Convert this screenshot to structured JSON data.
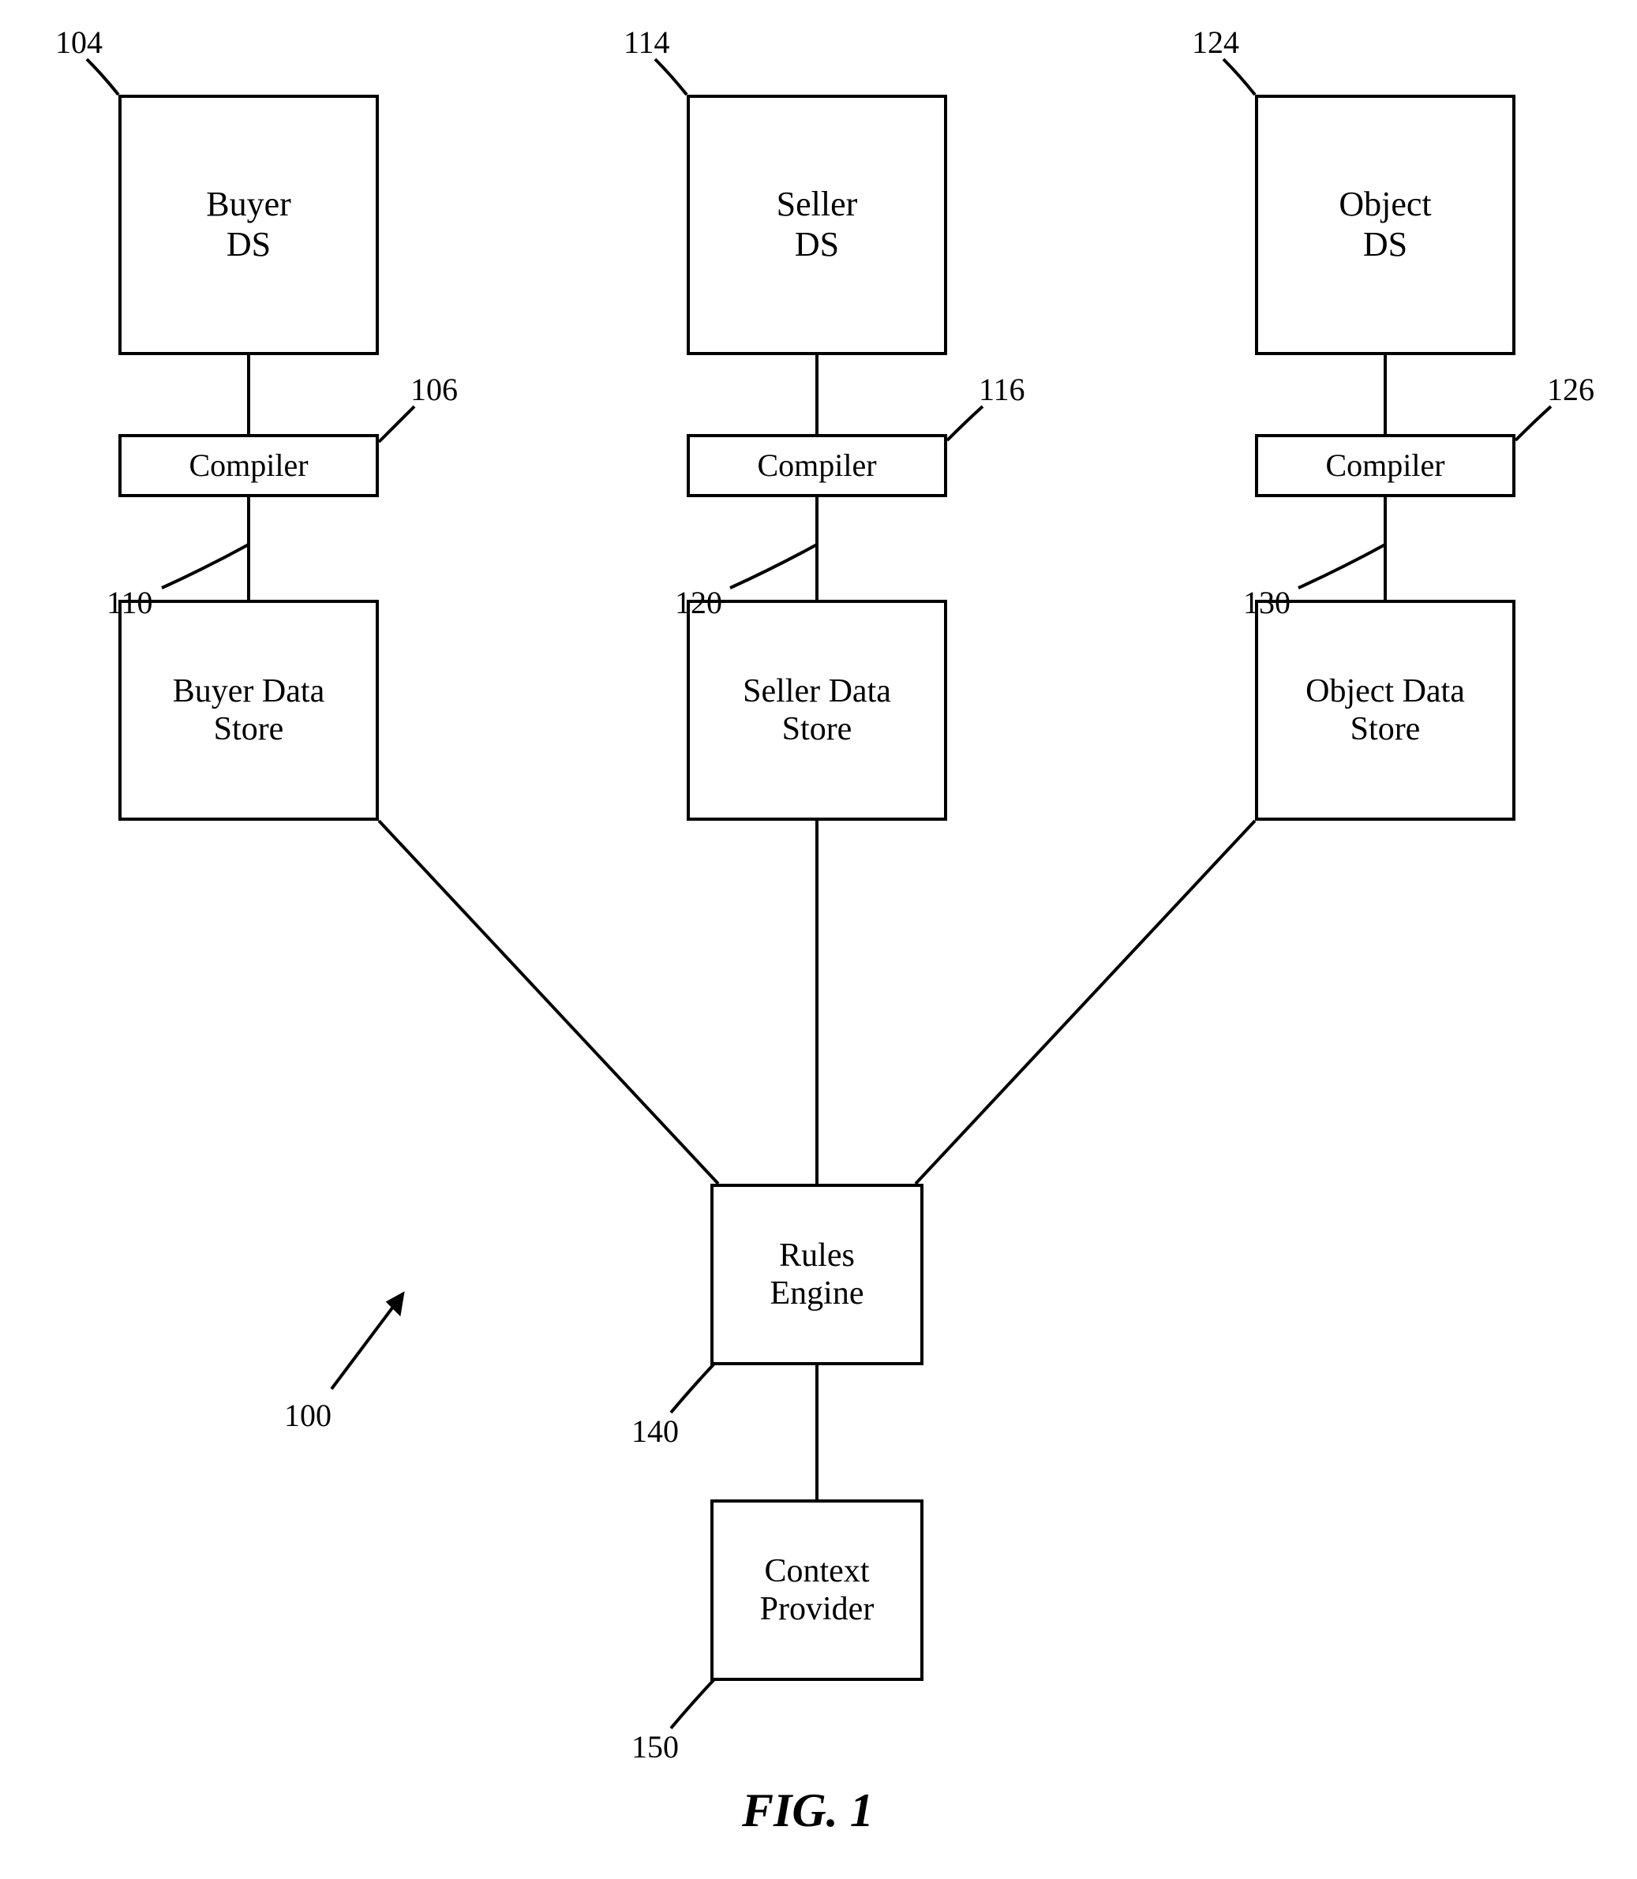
{
  "chart_data": {
    "type": "diagram",
    "title": "FIG. 1",
    "nodes": [
      {
        "id": "buyer_ds",
        "label": "Buyer DS",
        "ref": "104"
      },
      {
        "id": "buyer_compiler",
        "label": "Compiler",
        "ref": "106"
      },
      {
        "id": "buyer_store",
        "label": "Buyer Data Store",
        "ref": "110"
      },
      {
        "id": "seller_ds",
        "label": "Seller DS",
        "ref": "114"
      },
      {
        "id": "seller_compiler",
        "label": "Compiler",
        "ref": "116"
      },
      {
        "id": "seller_store",
        "label": "Seller Data Store",
        "ref": "120"
      },
      {
        "id": "object_ds",
        "label": "Object DS",
        "ref": "124"
      },
      {
        "id": "object_compiler",
        "label": "Compiler",
        "ref": "126"
      },
      {
        "id": "object_store",
        "label": "Object Data Store",
        "ref": "130"
      },
      {
        "id": "rules_engine",
        "label": "Rules Engine",
        "ref": "140"
      },
      {
        "id": "context_provider",
        "label": "Context Provider",
        "ref": "150"
      }
    ],
    "edges": [
      [
        "buyer_ds",
        "buyer_compiler"
      ],
      [
        "buyer_compiler",
        "buyer_store"
      ],
      [
        "seller_ds",
        "seller_compiler"
      ],
      [
        "seller_compiler",
        "seller_store"
      ],
      [
        "object_ds",
        "object_compiler"
      ],
      [
        "object_compiler",
        "object_store"
      ],
      [
        "buyer_store",
        "rules_engine"
      ],
      [
        "seller_store",
        "rules_engine"
      ],
      [
        "object_store",
        "rules_engine"
      ],
      [
        "rules_engine",
        "context_provider"
      ]
    ],
    "figure_ref": "100"
  },
  "labels": {
    "buyer_ds": "Buyer\nDS",
    "buyer_compiler": "Compiler",
    "buyer_store": "Buyer Data\nStore",
    "seller_ds": "Seller\nDS",
    "seller_compiler": "Compiler",
    "seller_store": "Seller Data\nStore",
    "object_ds": "Object\nDS",
    "object_compiler": "Compiler",
    "object_store": "Object Data\nStore",
    "rules_engine": "Rules\nEngine",
    "context_provider": "Context\nProvider",
    "ref_104": "104",
    "ref_106": "106",
    "ref_110": "110",
    "ref_114": "114",
    "ref_116": "116",
    "ref_120": "120",
    "ref_124": "124",
    "ref_126": "126",
    "ref_130": "130",
    "ref_140": "140",
    "ref_150": "150",
    "ref_100": "100",
    "figure": "FIG. 1"
  }
}
